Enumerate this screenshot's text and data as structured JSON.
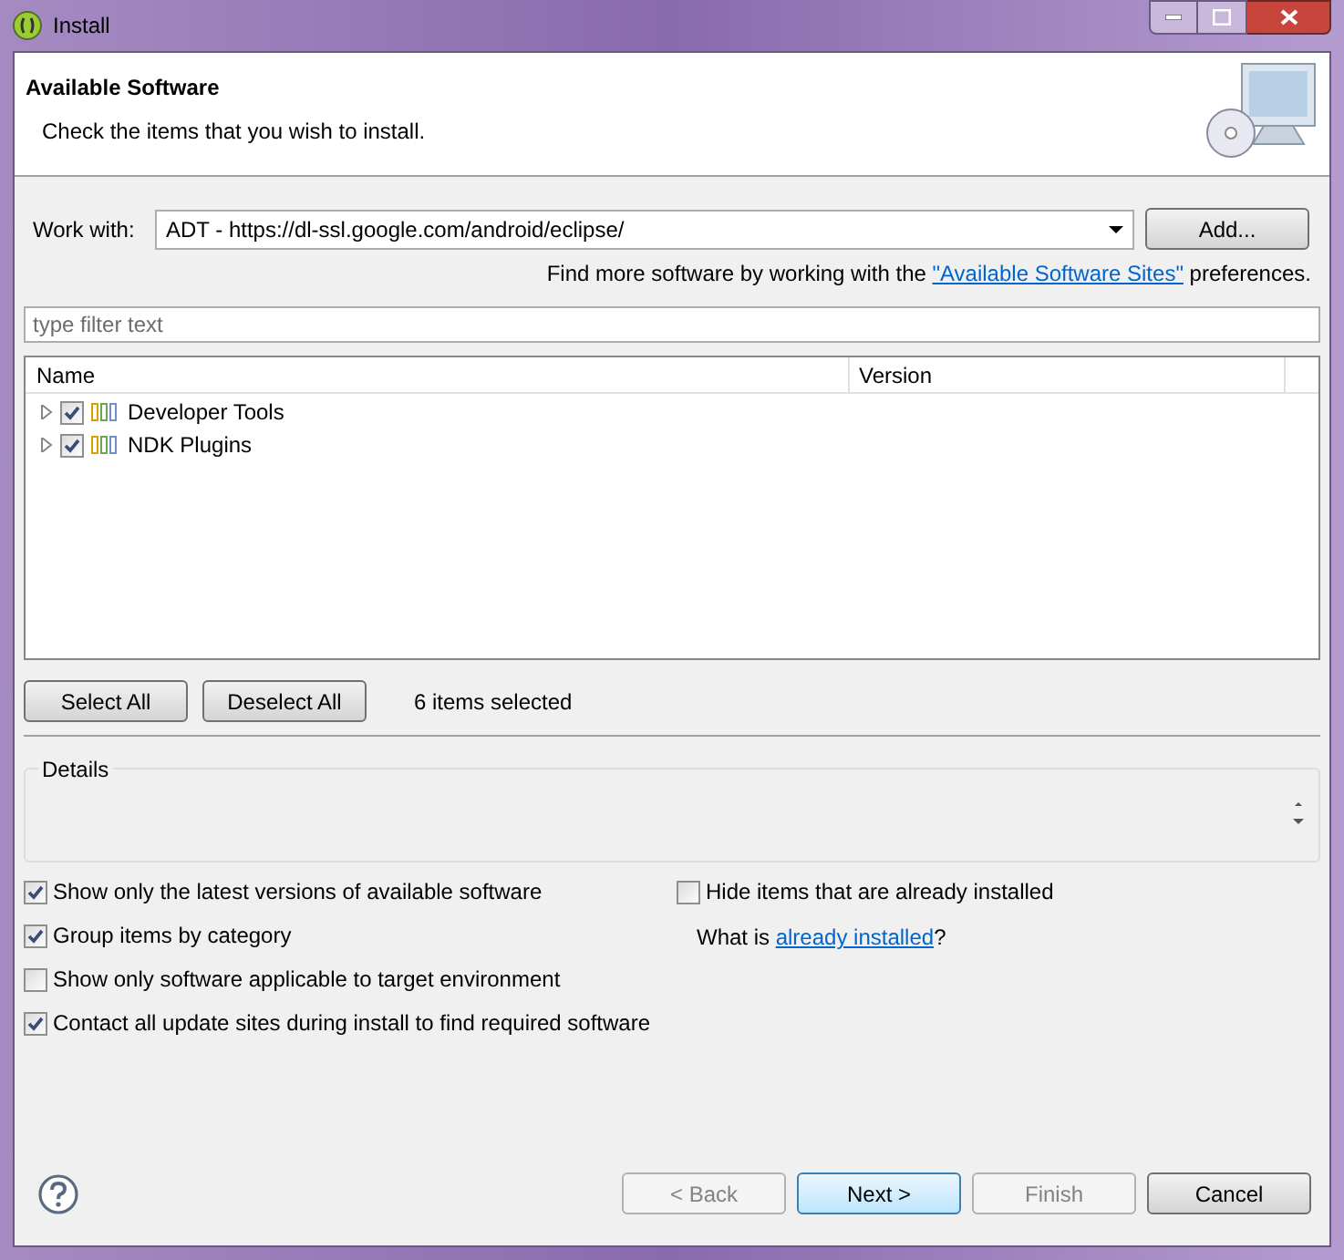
{
  "window": {
    "title": "Install"
  },
  "header": {
    "title": "Available Software",
    "description": "Check the items that you wish to install."
  },
  "work_with": {
    "label": "Work with:",
    "value": "ADT - https://dl-ssl.google.com/android/eclipse/",
    "add_button": "Add..."
  },
  "sites_hint": {
    "before": "Find more software by working with the",
    "link": "\"Available Software Sites\"",
    "after": "preferences."
  },
  "filter": {
    "placeholder": "type filter text"
  },
  "table": {
    "columns": [
      "Name",
      "Version"
    ],
    "rows": [
      {
        "name": "Developer Tools",
        "checked": true,
        "expanded": false
      },
      {
        "name": "NDK Plugins",
        "checked": true,
        "expanded": false
      }
    ]
  },
  "select_all": "Select All",
  "deselect_all": "Deselect All",
  "selection_count": "6 items selected",
  "details": {
    "title": "Details"
  },
  "options": [
    {
      "label": "Show only the latest versions of available software",
      "checked": true
    },
    {
      "label": "Group items by category",
      "checked": true
    },
    {
      "label": "Show only software applicable to target environment",
      "checked": false
    },
    {
      "label": "Contact all update sites during install to find required software",
      "checked": true
    }
  ],
  "hide_installed": {
    "label": "Hide items that are already installed",
    "checked": false
  },
  "installed_hint": {
    "before": "What is",
    "link": "already installed",
    "after": "?"
  },
  "buttons": [
    {
      "label": "< Back",
      "disabled": true,
      "default": false
    },
    {
      "label": "Next >",
      "disabled": false,
      "default": true
    },
    {
      "label": "Finish",
      "disabled": true,
      "default": false
    },
    {
      "label": "Cancel",
      "disabled": false,
      "default": false
    }
  ]
}
